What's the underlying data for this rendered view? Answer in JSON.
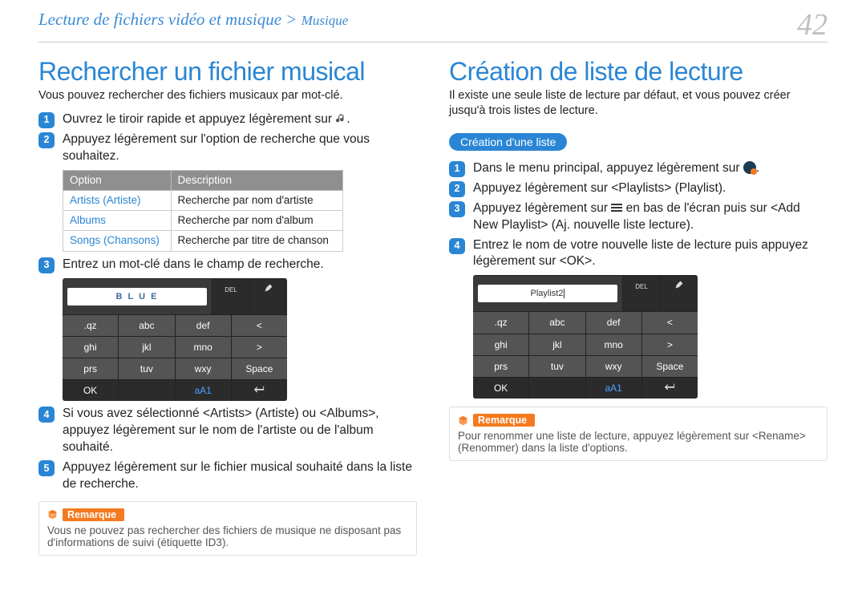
{
  "header": {
    "breadcrumb_main": "Lecture de fichiers vidéo et musique > ",
    "breadcrumb_section": "Musique",
    "page_number": "42"
  },
  "left": {
    "title": "Rechercher un fichier musical",
    "lead": "Vous pouvez rechercher des fichiers musicaux par mot-clé.",
    "step1": "Ouvrez le tiroir rapide et appuyez légèrement sur ",
    "step1_tail": ".",
    "step2": "Appuyez légèrement sur l'option de recherche que vous souhaitez.",
    "table": {
      "h1": "Option",
      "h2": "Description",
      "r1c1": "Artists (Artiste)",
      "r1c2": "Recherche par nom d'artiste",
      "r2c1": "Albums",
      "r2c2": "Recherche par nom d'album",
      "r3c1": "Songs (Chansons)",
      "r3c2": "Recherche par titre de chanson"
    },
    "step3": "Entrez un mot-clé dans le champ de recherche.",
    "keypad_input": "B L U E",
    "step4": "Si vous avez sélectionné <Artists> (Artiste) ou <Albums>, appuyez légèrement sur le nom de l'artiste ou de l'album souhaité.",
    "step5": "Appuyez légèrement sur le fichier musical souhaité dans la liste de recherche.",
    "note_label": "Remarque",
    "note_body": "Vous ne pouvez pas rechercher des fichiers de musique ne disposant pas d'informations de suivi (étiquette ID3)."
  },
  "right": {
    "title": "Création de liste de lecture",
    "lead": "Il existe une seule liste de lecture par défaut, et vous pouvez créer jusqu'à trois listes de lecture.",
    "pill": "Création d'une liste",
    "step1a": "Dans le menu principal, appuyez légèrement sur ",
    "step1b": ".",
    "step2": "Appuyez légèrement sur <Playlists> (Playlist).",
    "step3a": "Appuyez légèrement sur ",
    "step3b": " en bas de l'écran puis sur <Add New Playlist> (Aj. nouvelle liste lecture).",
    "step4": "Entrez le nom de votre nouvelle liste de lecture puis appuyez légèrement sur <OK>.",
    "keypad_input": "Playlist2",
    "note_label": "Remarque",
    "note_body": "Pour renommer une liste de lecture, appuyez légèrement sur <Rename> (Renommer) dans la liste d'options."
  },
  "keypad": {
    "del": "DEL",
    "r1": [
      ".qz",
      "abc",
      "def",
      "<"
    ],
    "r2": [
      "ghi",
      "jkl",
      "mno",
      ">"
    ],
    "r3": [
      "prs",
      "tuv",
      "wxy",
      "Space"
    ],
    "r4": [
      "OK",
      "",
      "aA1",
      "↩"
    ]
  }
}
